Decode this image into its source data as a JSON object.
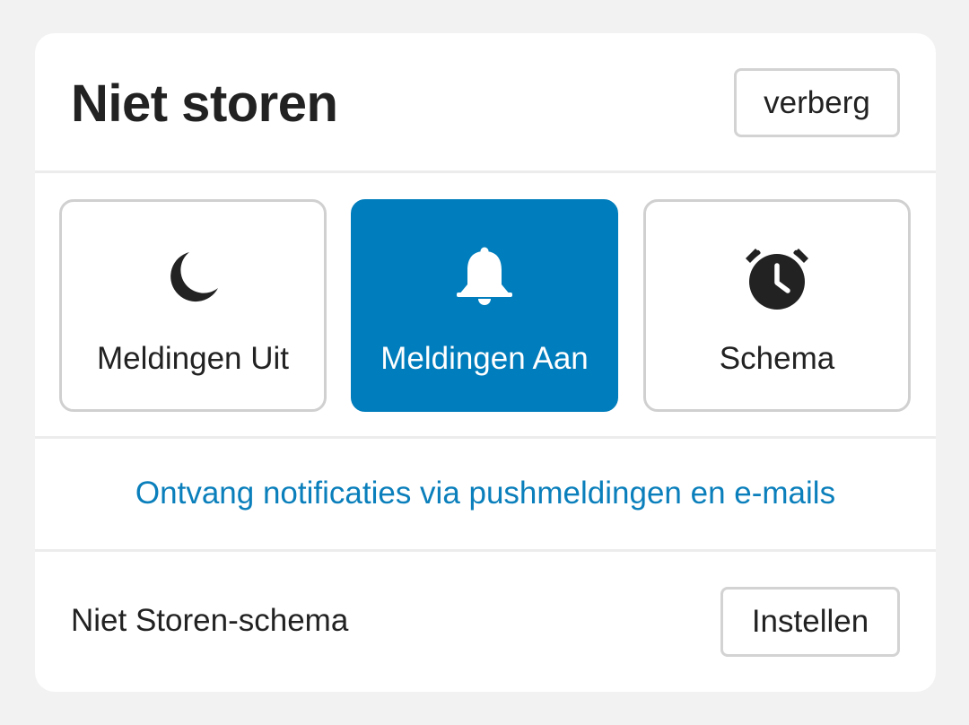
{
  "panel": {
    "title": "Niet storen",
    "hide_label": "verberg"
  },
  "modes": [
    {
      "label": "Meldingen Uit",
      "icon": "moon-icon",
      "selected": false
    },
    {
      "label": "Meldingen Aan",
      "icon": "bell-icon",
      "selected": true
    },
    {
      "label": "Schema",
      "icon": "alarm-clock-icon",
      "selected": false
    }
  ],
  "info": {
    "text": "Ontvang notificaties via pushmeldingen en e-mails"
  },
  "schedule": {
    "label": "Niet Storen-schema",
    "button_label": "Instellen"
  },
  "colors": {
    "accent": "#007dbc",
    "link": "#0a7fbb",
    "text": "#222222",
    "border": "#d0d0d0",
    "background": "#f2f2f2"
  }
}
